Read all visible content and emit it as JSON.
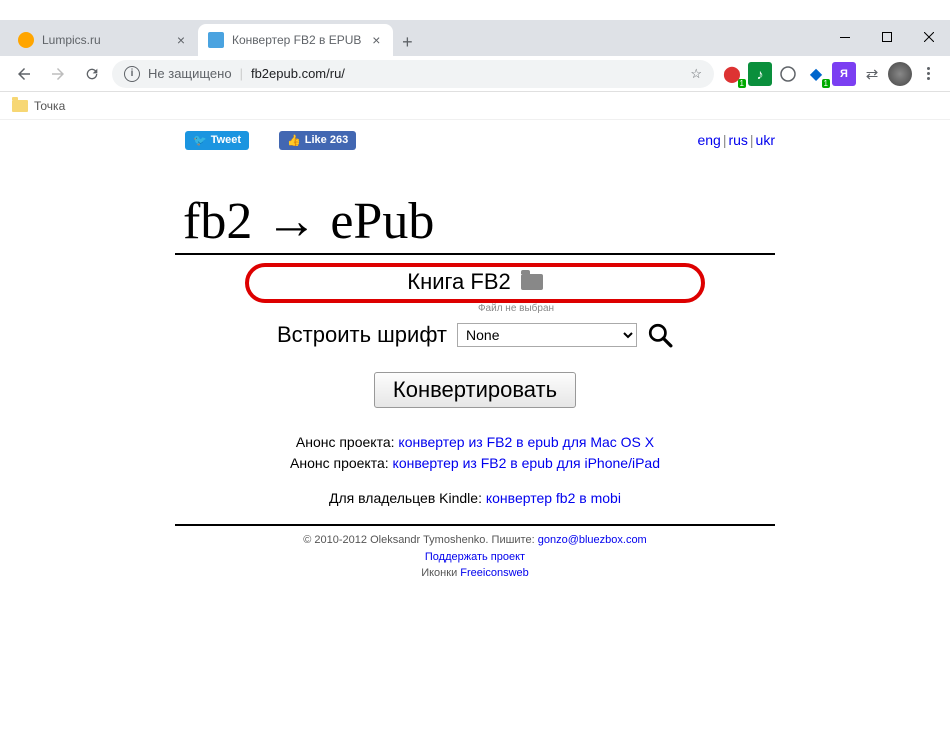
{
  "browser": {
    "tabs": [
      {
        "title": "Lumpics.ru",
        "favicon_color": "#ffa500"
      },
      {
        "title": "Конвертер FB2 в EPUB",
        "favicon_color": "#4aa3e0"
      }
    ],
    "security_label": "Не защищено",
    "url": "fb2epub.com/ru/",
    "bookmark_label": "Точка"
  },
  "social": {
    "tweet": "Tweet",
    "like": "Like 263"
  },
  "lang": {
    "eng": "eng",
    "rus": "rus",
    "ukr": "ukr"
  },
  "logo": "fb2 → ePub",
  "form": {
    "book_label": "Книга FB2",
    "file_hint": "Файл не выбран",
    "font_label": "Встроить шрифт",
    "font_selected": "None",
    "convert": "Конвертировать"
  },
  "announce": {
    "prefix": "Анонс проекта: ",
    "link1": "конвертер из FB2 в epub для Mac OS X",
    "link2": "конвертер из FB2 в epub для iPhone/iPad",
    "kindle_prefix": "Для владельцев Kindle: ",
    "kindle_link": "конвертер fb2 в mobi"
  },
  "footer": {
    "copyright": "© 2010-2012 Oleksandr Tymoshenko. Пишите: ",
    "email": "gonzo@bluezbox.com",
    "support": "Поддержать проект",
    "icons_prefix": "Иконки ",
    "icons_link": "Freeiconsweb"
  }
}
